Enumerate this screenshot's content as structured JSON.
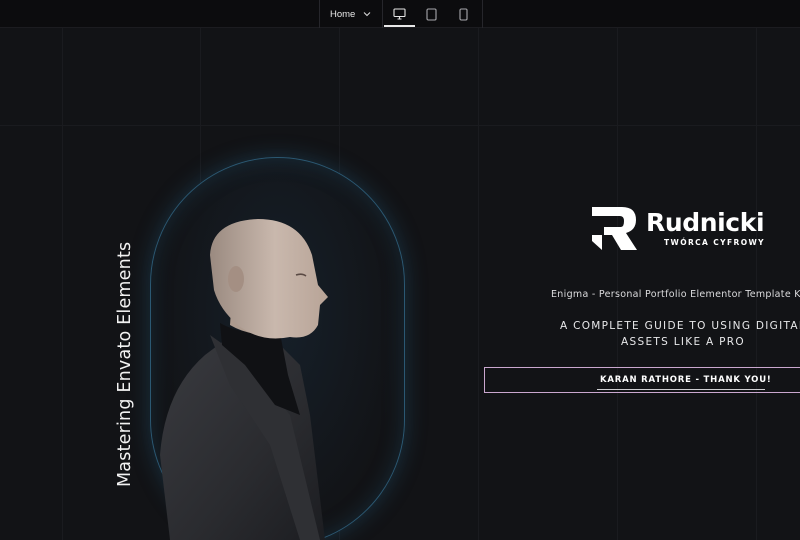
{
  "toolbar": {
    "page_select_label": "Home",
    "devices": [
      {
        "name": "desktop",
        "active": true
      },
      {
        "name": "tablet",
        "active": false
      },
      {
        "name": "mobile",
        "active": false
      }
    ]
  },
  "hero": {
    "vertical_title": "Mastering Envato Elements",
    "logo": {
      "name": "Rudnicki",
      "subtitle": "TWÓRCA CYFROWY"
    },
    "template_title": "Enigma - Personal Portfolio Elementor Template K",
    "guide_line1": "A COMPLETE GUIDE TO USING DIGITAL",
    "guide_line2": "ASSETS LIKE A PRO",
    "cta_label": "KARAN RATHORE - THANK YOU!"
  },
  "colors": {
    "background": "#121316",
    "capsule_glow": "#2b5872",
    "cta_border": "#caa7cf",
    "text": "#ffffff"
  }
}
